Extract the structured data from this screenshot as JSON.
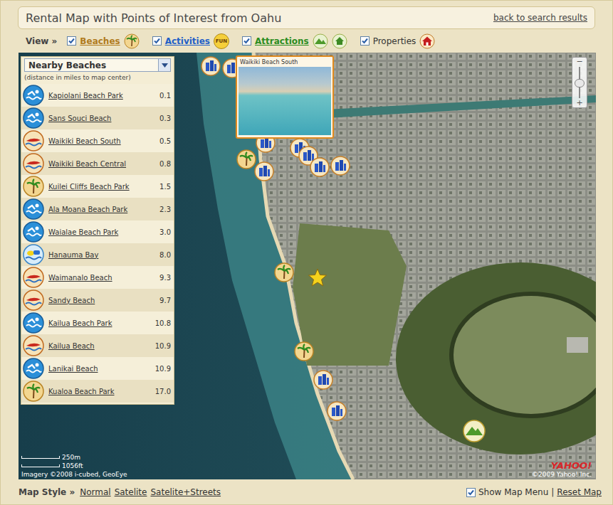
{
  "header": {
    "title": "Rental Map with Points of Interest from Oahu",
    "back_link": "back to search results"
  },
  "view": {
    "label": "View »",
    "filters": [
      {
        "label": "Beaches",
        "checked": true,
        "kind": "link",
        "color": "#b07a1c"
      },
      {
        "label": "Activities",
        "checked": true,
        "kind": "link",
        "color": "#1f5fc8",
        "badge": "FUN"
      },
      {
        "label": "Attractions",
        "checked": true,
        "kind": "link",
        "color": "#2a8c1e"
      },
      {
        "label": "Properties",
        "checked": true,
        "kind": "plain",
        "color": "#333333"
      }
    ]
  },
  "beach_panel": {
    "dropdown": "Nearby Beaches",
    "note": "(distance in miles to map center)",
    "items": [
      {
        "name": "Kapiolani Beach Park",
        "distance": "0.1",
        "kind": "swim"
      },
      {
        "name": "Sans Souci Beach",
        "distance": "0.3",
        "kind": "swim"
      },
      {
        "name": "Waikiki Beach South",
        "distance": "0.5",
        "kind": "surf"
      },
      {
        "name": "Waikiki Beach Central",
        "distance": "0.8",
        "kind": "surf"
      },
      {
        "name": "Kuilei Cliffs Beach Park",
        "distance": "1.5",
        "kind": "palm"
      },
      {
        "name": "Ala Moana Beach Park",
        "distance": "2.3",
        "kind": "swim"
      },
      {
        "name": "Waialae Beach Park",
        "distance": "3.0",
        "kind": "swim"
      },
      {
        "name": "Hanauma Bay",
        "distance": "8.0",
        "kind": "snorkel"
      },
      {
        "name": "Waimanalo Beach",
        "distance": "9.3",
        "kind": "surf"
      },
      {
        "name": "Sandy Beach",
        "distance": "9.7",
        "kind": "surf"
      },
      {
        "name": "Kailua Beach Park",
        "distance": "10.8",
        "kind": "swim"
      },
      {
        "name": "Kailua Beach",
        "distance": "10.9",
        "kind": "surf"
      },
      {
        "name": "Lanikai Beach",
        "distance": "10.9",
        "kind": "swim"
      },
      {
        "name": "Kualoa Beach Park",
        "distance": "17.0",
        "kind": "palm"
      }
    ]
  },
  "popup": {
    "title": "Waikiki Beach South"
  },
  "zoom": {
    "out": "−",
    "in": "+",
    "level": 0.6
  },
  "scale": {
    "metric": "250m",
    "imperial": "1056ft"
  },
  "credits": {
    "imagery": "Imagery ©2008 i-cubed, GeoEye",
    "logo": "YAHOO!",
    "copyright": "©2009 Yahoo! Inc."
  },
  "footer": {
    "label": "Map Style »",
    "styles": [
      "Normal",
      "Satelite",
      "Satelite+Streets"
    ],
    "show_menu": {
      "label": "Show Map Menu",
      "checked": true
    },
    "separator": "|",
    "reset": "Reset Map"
  }
}
